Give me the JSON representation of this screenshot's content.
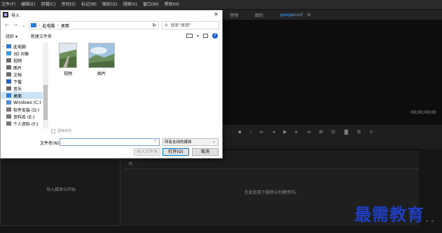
{
  "menubar": {
    "items": [
      "文件(F)",
      "编辑(E)",
      "剪辑(C)",
      "序列(S)",
      "标记(M)",
      "图形(G)",
      "视图(V)",
      "窗口(W)",
      "帮助(H)"
    ]
  },
  "workspace_tabs": {
    "tab1": "音频",
    "tab2": "图形",
    "tab3": "gonganuof",
    "close_glyph": "≡",
    "active_color": "#4aa8ff"
  },
  "program_monitor": {
    "timecode": "00;00;00;00"
  },
  "project_panel": {
    "hint": "导入媒体以开始"
  },
  "timeline": {
    "hint": "在此处放下媒体以创建序列。"
  },
  "dialog": {
    "title": "导入",
    "close_glyph": "✕",
    "nav": {
      "back": "←",
      "forward": "→",
      "dropdown": "⌄",
      "up": "↑",
      "breadcrumb": [
        "此电脑",
        "桌面"
      ],
      "separator": "›",
      "refresh": "↻",
      "search_placeholder": "搜索\"桌面\""
    },
    "toolbar": {
      "organize": "组织 ▾",
      "new_folder": "新建文件夹",
      "help": "?"
    },
    "tree": [
      {
        "label": "此电脑",
        "icon_color": "#2d7cd6"
      },
      {
        "label": "3D 对象",
        "icon_color": "#3c9be0"
      },
      {
        "label": "视频",
        "icon_color": "#6b6b6b"
      },
      {
        "label": "图片",
        "icon_color": "#6b6b6b"
      },
      {
        "label": "文档",
        "icon_color": "#6b6b6b"
      },
      {
        "label": "下载",
        "icon_color": "#1e64c8"
      },
      {
        "label": "音乐",
        "icon_color": "#6b6b6b"
      },
      {
        "label": "桌面",
        "icon_color": "#2d7cd6"
      },
      {
        "label": "Windows (C:)",
        "icon_color": "#4a90d9"
      },
      {
        "label": "软件安装 (D:)",
        "icon_color": "#777777"
      },
      {
        "label": "资料库 (E:)",
        "icon_color": "#777777"
      },
      {
        "label": "个人资料 (F:)",
        "icon_color": "#777777"
      }
    ],
    "files": [
      {
        "name": "视频"
      },
      {
        "name": "图片"
      }
    ],
    "sequence_checkbox": "图像序列",
    "filename_label": "文件名(N):",
    "filename_value": "",
    "filetype": "所有支持的媒体",
    "buttons": {
      "import_folder": "导入文件夹",
      "open": "打开(O)",
      "cancel": "取消"
    }
  },
  "watermark": "最需教育"
}
